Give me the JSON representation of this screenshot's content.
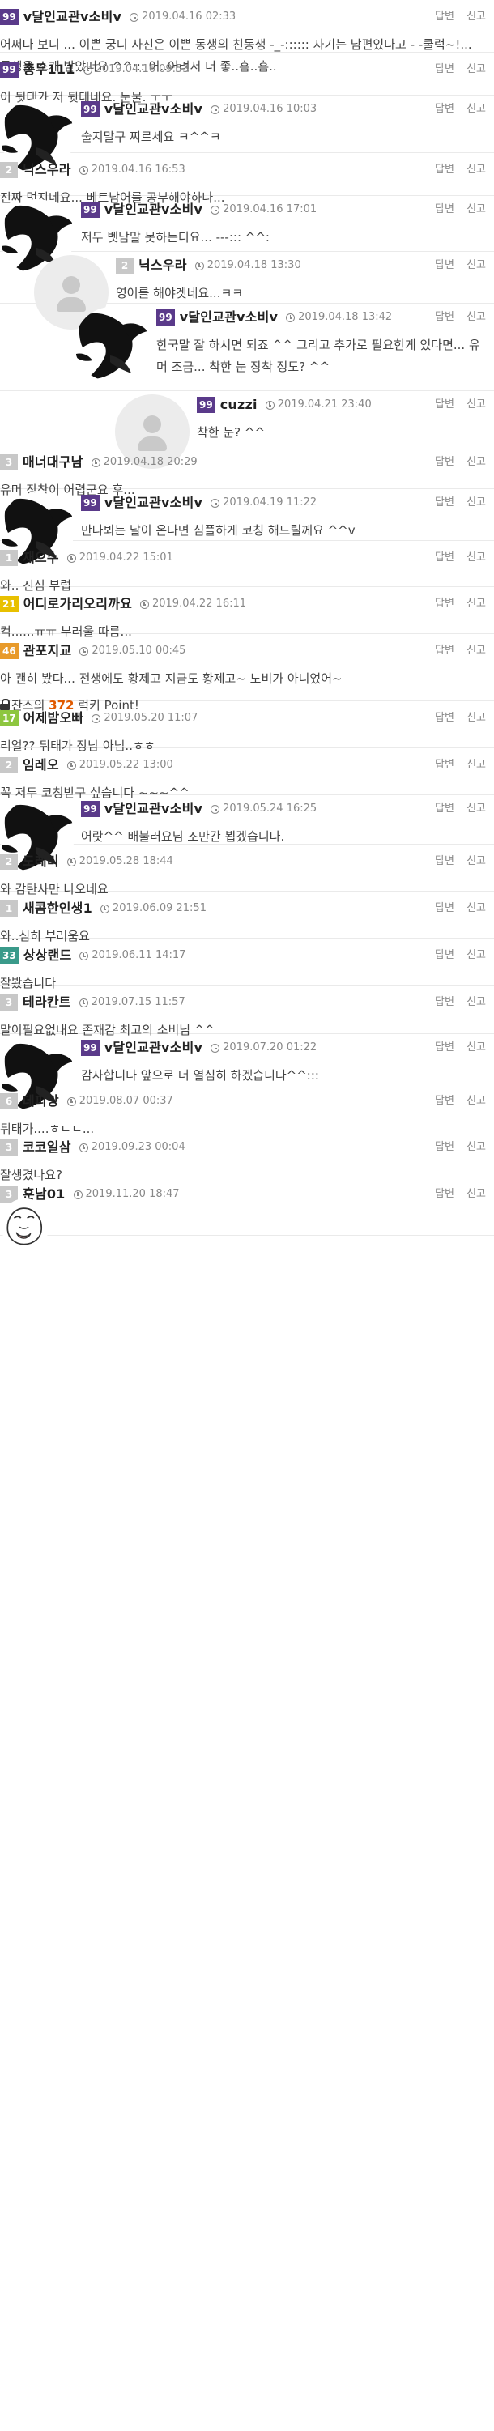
{
  "actions": {
    "reply": "답변",
    "report": "신고"
  },
  "level_colors": {
    "default": "#c8c8c8",
    "purple": "#5a3a8a",
    "yellow": "#e8c000",
    "orange": "#e89a2a",
    "green": "#8dc63f",
    "teal": "#3a9a8a"
  },
  "comments": [
    {
      "depth": 0,
      "avatar": "none",
      "level": "99",
      "level_color": "purple",
      "nick": "v달인교관v소비v",
      "date": "2019.04.16 02:33",
      "text": "어쩌다 보니 ... 이쁜 궁디 사진은 이쁜 동생의 친동생 -_-:::::: 자기는 남편있다고 - -쿨럭~!... 동생을 소개 받았떠요 ^^::: 어..어려서 더 좋..흠..흠.."
    },
    {
      "depth": 0,
      "avatar": "none",
      "level": "99",
      "level_color": "purple",
      "nick": "총무111",
      "date": "2019.04.16 09:53",
      "text": "이 뒷태가 저 뒷태네요. 눈물. ㅜㅜ"
    },
    {
      "depth": 1,
      "avatar": "black",
      "level": "99",
      "level_color": "purple",
      "nick": "v달인교관v소비v",
      "date": "2019.04.16 10:03",
      "text": "술지말구 찌르세요 ㅋ^^ㅋ"
    },
    {
      "depth": 0,
      "avatar": "none",
      "level": "2",
      "level_color": "default",
      "nick": "닉스우라",
      "date": "2019.04.16 16:53",
      "text": "진짜 멋지네요... 베트남어를 공부해야하나..."
    },
    {
      "depth": 1,
      "avatar": "black",
      "level": "99",
      "level_color": "purple",
      "nick": "v달인교관v소비v",
      "date": "2019.04.16 17:01",
      "text": "저두 벳남말 못하는디요... ---::: ^^:"
    },
    {
      "depth": 2,
      "avatar": "default",
      "level": "2",
      "level_color": "default",
      "nick": "닉스우라",
      "date": "2019.04.18 13:30",
      "text": "영어를 해야겟네요...ㅋㅋ"
    },
    {
      "depth": 3,
      "avatar": "black",
      "level": "99",
      "level_color": "purple",
      "nick": "v달인교관v소비v",
      "date": "2019.04.18 13:42",
      "text": "한국말 잘 하시면 되죠 ^^ 그리고 추가로 필요한게 있다면... 유머 조금... 착한 눈 장착 정도? ^^"
    },
    {
      "depth": 4,
      "avatar": "default",
      "level": "99",
      "level_color": "purple",
      "nick": "cuzzi",
      "date": "2019.04.21 23:40",
      "text": "착한 눈? ^^"
    },
    {
      "depth": 0,
      "avatar": "none",
      "level": "3",
      "level_color": "default",
      "nick": "매너대구남",
      "date": "2019.04.18 20:29",
      "text": "유머 장착이 어렵군요 후..."
    },
    {
      "depth": 1,
      "avatar": "black",
      "level": "99",
      "level_color": "purple",
      "nick": "v달인교관v소비v",
      "date": "2019.04.19 11:22",
      "text": "만나뵈는 날이 온다면 심플하게 코칭 해드릴께요 ^^v"
    },
    {
      "depth": 0,
      "avatar": "none",
      "level": "1",
      "level_color": "default",
      "nick": "재으수",
      "date": "2019.04.22 15:01",
      "text": "와.. 진심 부럽"
    },
    {
      "depth": 0,
      "avatar": "none",
      "level": "21",
      "level_color": "yellow",
      "nick": "어디로가리오리까요",
      "date": "2019.04.22 16:11",
      "text": "컥......ㅠㅠ 부러울 따름..."
    },
    {
      "depth": 0,
      "avatar": "none",
      "level": "46",
      "level_color": "orange",
      "nick": "관포지교",
      "date": "2019.05.10 00:45",
      "text": "아 괜히 봤다... 전생에도 황제고 지금도 황제고~ 노비가 아니었어~",
      "point": {
        "prefix": "잔스의 ",
        "value": "372",
        "suffix": " 럭키 Point!"
      }
    },
    {
      "depth": 0,
      "avatar": "none",
      "level": "17",
      "level_color": "green",
      "nick": "어제밤오빠",
      "date": "2019.05.20 11:07",
      "text": "리얼?? 뒤태가 장남 아님..ㅎㅎ"
    },
    {
      "depth": 0,
      "avatar": "none",
      "level": "2",
      "level_color": "default",
      "nick": "임레오",
      "date": "2019.05.22 13:00",
      "text": "꼭 저두 코칭받구 싶습니다 ~~~^^"
    },
    {
      "depth": 1,
      "avatar": "black",
      "level": "99",
      "level_color": "purple",
      "nick": "v달인교관v소비v",
      "date": "2019.05.24 16:25",
      "text": "어랏^^ 배불러요님 조만간 뵙겠습니다."
    },
    {
      "depth": 0,
      "avatar": "none",
      "level": "2",
      "level_color": "default",
      "nick": "도레미",
      "date": "2019.05.28 18:44",
      "text": "와 감탄사만 나오네요"
    },
    {
      "depth": 0,
      "avatar": "none",
      "level": "1",
      "level_color": "default",
      "nick": "새콤한인생1",
      "date": "2019.06.09 21:51",
      "text": "와..심히 부러움요"
    },
    {
      "depth": 0,
      "avatar": "none",
      "level": "33",
      "level_color": "teal",
      "nick": "상상랜드",
      "date": "2019.06.11 14:17",
      "text": "잘봤습니다"
    },
    {
      "depth": 0,
      "avatar": "none",
      "level": "3",
      "level_color": "default",
      "nick": "테라칸트",
      "date": "2019.07.15 11:57",
      "text": "말이필요없내요 존재감 최고의 소비님 ^^"
    },
    {
      "depth": 1,
      "avatar": "black",
      "level": "99",
      "level_color": "purple",
      "nick": "v달인교관v소비v",
      "date": "2019.07.20 01:22",
      "text": "감사합니다 앞으로 더 열심히 하겠습니다^^:::"
    },
    {
      "depth": 0,
      "avatar": "none",
      "level": "6",
      "level_color": "default",
      "nick": "데피앙",
      "date": "2019.08.07 00:37",
      "text": "뒤태가....ㅎㄷㄷ..."
    },
    {
      "depth": 0,
      "avatar": "none",
      "level": "3",
      "level_color": "default",
      "nick": "코코일삼",
      "date": "2019.09.23 00:04",
      "text": "잘생겼나요?"
    },
    {
      "depth": 0,
      "avatar": "face",
      "level": "3",
      "level_color": "default",
      "nick": "훈남01",
      "date": "2019.11.20 18:47",
      "text": ""
    }
  ]
}
